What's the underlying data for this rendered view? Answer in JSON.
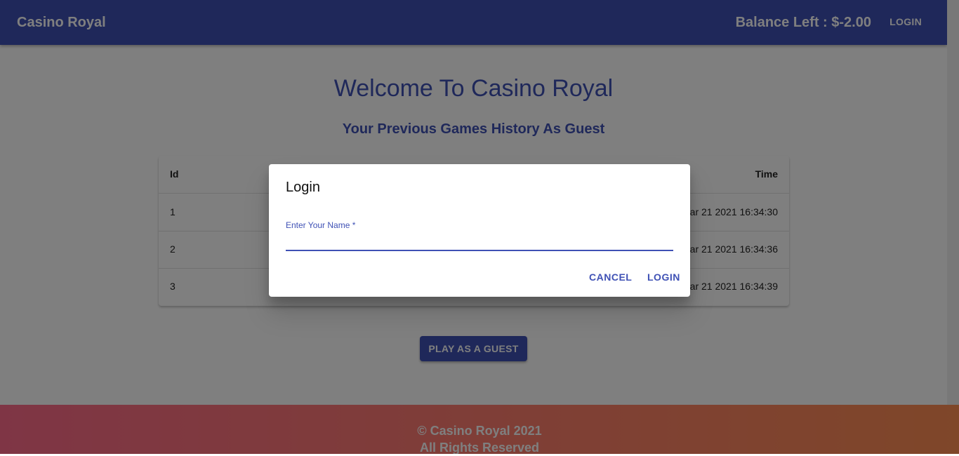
{
  "appbar": {
    "brand": "Casino Royal",
    "balance": "Balance Left : $-2.00",
    "login_label": "LOGIN"
  },
  "main": {
    "welcome": "Welcome To Casino Royal",
    "history_title": "Your Previous Games History As Guest",
    "table": {
      "columns": [
        "Id",
        "Time"
      ],
      "rows": [
        {
          "id": "1",
          "time": "ar 21 2021 16:34:30"
        },
        {
          "id": "2",
          "time": "ar 21 2021 16:34:36"
        },
        {
          "id": "3",
          "time": "ar 21 2021 16:34:39"
        }
      ]
    },
    "guest_button": "PLAY AS A GUEST"
  },
  "footer": {
    "copyright": "© Casino Royal 2021",
    "rights": "All Rights Reserved"
  },
  "dialog": {
    "title": "Login",
    "field_label": "Enter Your Name *",
    "field_value": "",
    "cancel_label": "CANCEL",
    "login_label": "LOGIN"
  },
  "colors": {
    "primary": "#3f51b5",
    "footer_gradient_start": "#fe6b8b",
    "footer_gradient_end": "#ff8e53"
  }
}
